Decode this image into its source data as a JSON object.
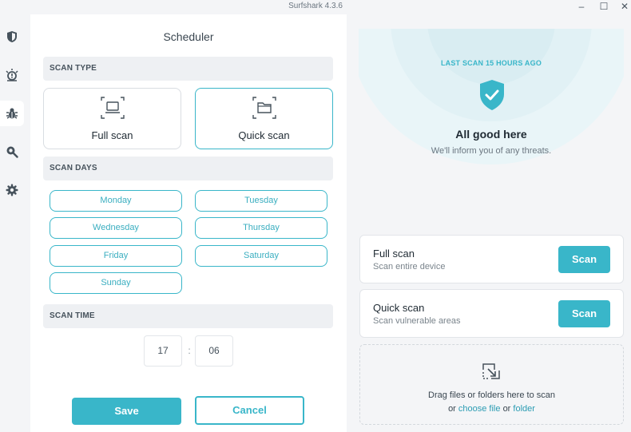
{
  "window": {
    "title": "Surfshark 4.3.6",
    "minimize": "–",
    "maximize": "☐",
    "close": "✕"
  },
  "sidebar": {
    "items": [
      {
        "name": "shield-icon",
        "active": false
      },
      {
        "name": "alert-icon",
        "active": false
      },
      {
        "name": "bug-icon",
        "active": true
      },
      {
        "name": "search-icon",
        "active": false
      },
      {
        "name": "gear-icon",
        "active": false
      }
    ]
  },
  "scheduler": {
    "title": "Scheduler",
    "scan_type_header": "SCAN TYPE",
    "scan_types": [
      {
        "label": "Full scan",
        "selected": false,
        "icon": "laptop-icon"
      },
      {
        "label": "Quick scan",
        "selected": true,
        "icon": "folder-icon"
      }
    ],
    "scan_days_header": "SCAN DAYS",
    "days": [
      "Monday",
      "Tuesday",
      "Wednesday",
      "Thursday",
      "Friday",
      "Saturday",
      "Sunday"
    ],
    "scan_time_header": "SCAN TIME",
    "hour": "17",
    "separator": ":",
    "minute": "06",
    "save_label": "Save",
    "cancel_label": "Cancel"
  },
  "status": {
    "last_scan": "LAST SCAN 15 HOURS AGO",
    "headline": "All good here",
    "subtitle": "We'll inform you of any threats."
  },
  "scan_options": [
    {
      "title": "Full scan",
      "subtitle": "Scan entire device",
      "button": "Scan"
    },
    {
      "title": "Quick scan",
      "subtitle": "Scan vulnerable areas",
      "button": "Scan"
    }
  ],
  "dropzone": {
    "line1": "Drag files or folders here to scan",
    "or1": "or",
    "choose_file": "choose file",
    "or2": "or",
    "folder": "folder"
  },
  "colors": {
    "accent": "#39b6c9",
    "text": "#1f2a33",
    "muted": "#7a848c"
  }
}
